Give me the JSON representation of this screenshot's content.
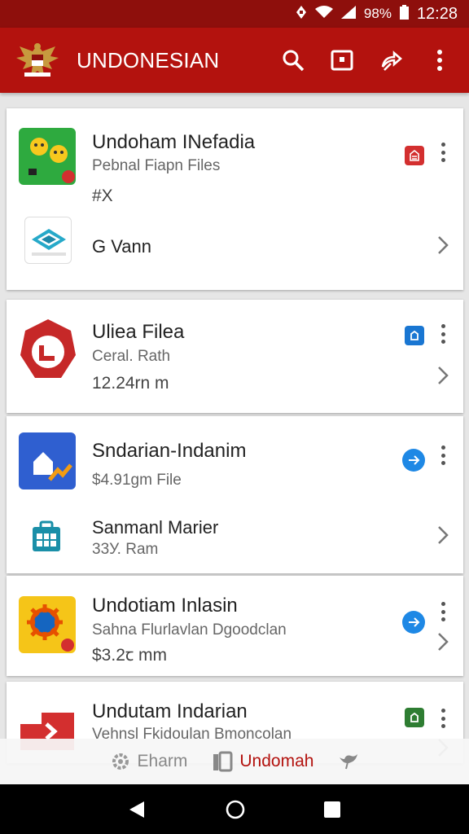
{
  "status": {
    "battery": "98%",
    "time": "12:28"
  },
  "appbar": {
    "title": "UNDONESIAN"
  },
  "cards": [
    {
      "name": "Undoham INefadia",
      "sub": "Pebnal Fiapn Files",
      "meta": "#X",
      "badge_color": "#d32f2f"
    },
    {
      "name": "G Vann"
    },
    {
      "name": "Uliea Filea",
      "sub": "Ceral. Rath",
      "meta": "12.24rn m",
      "badge_color": "#1976d2"
    },
    {
      "name": "Sndarian-Indanim",
      "sub": "$4.91ɡm File",
      "badge_color": "#1e88e5"
    },
    {
      "name": "Sanmanl Marier",
      "sub": "33У. Ram"
    },
    {
      "name": "Undotiam Inlasin",
      "sub": "Sahna Flurlavlan Dgoodclan",
      "meta": "$3.2ꞇ mm",
      "badge_color": "#1e88e5"
    },
    {
      "name": "Undutam Indarian",
      "sub": "Vehnsl Fkidoulan Bmoncolan",
      "badge_color": "#2e7d32"
    }
  ],
  "tabs": [
    {
      "label": "Eharm"
    },
    {
      "label": "Undomah"
    },
    {
      "label": ""
    }
  ],
  "colors": {
    "primary": "#b3120e",
    "statusbar": "#8e0f0c"
  }
}
